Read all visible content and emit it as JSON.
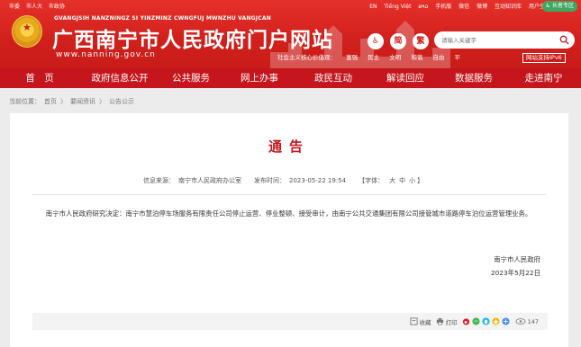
{
  "topbar": {
    "left": [
      "市委",
      "市人大",
      "市政协"
    ],
    "right": [
      "EN",
      "Tiếng Việt",
      "ລາວ",
      "手机版",
      "微信",
      "微博",
      "互动知识库",
      "用户空间"
    ],
    "elder": "长者专区"
  },
  "header": {
    "pinyin": "GVANGJSIH NANZNINGZ SI YINZMINZ CWNGFUJ MWNZHU VANGJCAN",
    "sitename": "广西南宁市人民政府门户网站",
    "domain": "www.nanning.gov.cn",
    "values_label": "社会主义核心价值观：",
    "values": [
      "富强",
      "民主",
      "文明",
      "和谐",
      "自由",
      "平"
    ],
    "search_placeholder": "请输入关键字",
    "ipv6": "网站支持IPv6",
    "acc_btns": [
      "♿",
      "简",
      "繁"
    ]
  },
  "nav": [
    "首　页",
    "政府信息公开",
    "公共服务",
    "网上办事",
    "政民互动",
    "解读回应",
    "数据服务",
    "走进南宁"
  ],
  "breadcrumb": {
    "label": "当前位置：",
    "items": [
      "首页",
      "要闻资讯",
      "公告公示"
    ],
    "sep": "〉"
  },
  "article": {
    "title": "通告",
    "source_label": "信息来源：",
    "source": "南宁市人民政府办公室",
    "date_label": "发布时间：",
    "date": "2023-05-22 19:54",
    "font_open": "【字体：",
    "font_sizes": [
      "大",
      "中",
      "小"
    ],
    "font_close": "】",
    "body": "南宁市人民政府研究决定：南宁市慧泊停车场服务有限责任公司停止运营、停业整顿、接受审计，由南宁公共交通集团有限公司接管城市道路停车泊位运营管理业务。",
    "sign": "南宁市人民政府",
    "sign_date": "2023年5月22日"
  },
  "tools": {
    "fav": "收藏",
    "print": "打印",
    "views": "147"
  },
  "colors": {
    "brand_red": "#c4161c",
    "elder_green": "#3ea862"
  }
}
